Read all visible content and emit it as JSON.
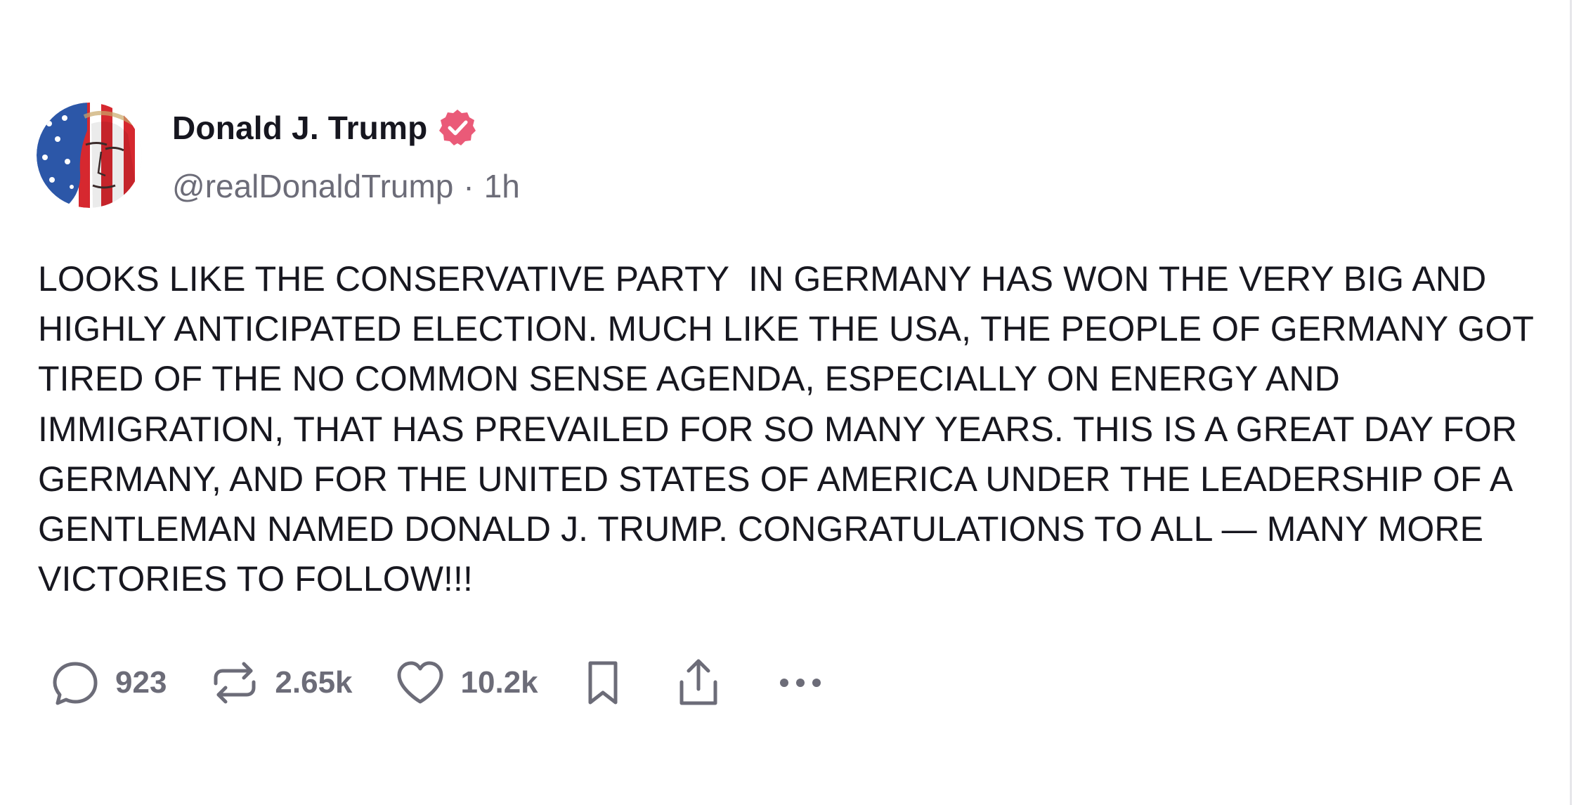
{
  "post": {
    "author": {
      "display_name": "Donald J. Trump",
      "verified": true,
      "handle": "@realDonaldTrump",
      "avatar": "flag-face-avatar"
    },
    "separator": "·",
    "time": "1h",
    "text": "LOOKS LIKE THE CONSERVATIVE PARTY  IN GERMANY HAS WON THE VERY BIG AND HIGHLY ANTICIPATED ELECTION. MUCH LIKE THE USA, THE PEOPLE OF GERMANY GOT TIRED OF THE NO COMMON SENSE AGENDA, ESPECIALLY ON ENERGY AND IMMIGRATION, THAT HAS PREVAILED FOR SO MANY YEARS. THIS IS A GREAT DAY FOR GERMANY, AND FOR THE UNITED STATES OF AMERICA UNDER THE LEADERSHIP OF A GENTLEMAN NAMED DONALD J. TRUMP. CONGRATULATIONS TO ALL — MANY MORE VICTORIES TO FOLLOW!!!",
    "actions": {
      "reply_count": "923",
      "repost_count": "2.65k",
      "like_count": "10.2k"
    },
    "icons": {
      "reply": "reply-bubble-icon",
      "repost": "repost-icon",
      "like": "heart-icon",
      "bookmark": "bookmark-icon",
      "share": "share-icon",
      "more": "more-icon",
      "verified": "verified-badge-icon"
    }
  },
  "colors": {
    "text": "#17171f",
    "muted": "#6c6c78",
    "verified_badge": "#ea5a78",
    "background": "#ffffff"
  }
}
